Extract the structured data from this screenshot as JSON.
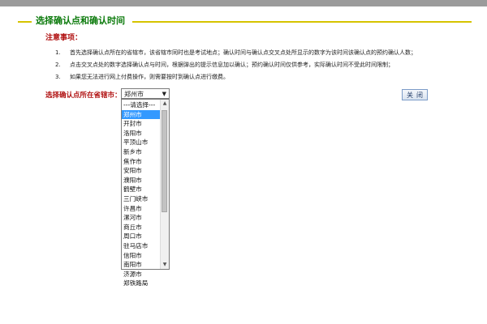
{
  "header": {
    "title": "选择确认点和确认时间"
  },
  "notice": {
    "title": "注意事项：",
    "items": [
      {
        "num": "1.",
        "text": "首先选择确认点所在的省辖市，该省辖市同时也是考试地点；确认时间与确认点交叉点处所显示的数字为该时间该确认点的预约确认人数；"
      },
      {
        "num": "2.",
        "text": "点击交叉点处的数字选择确认点与时间，根据弹出的提示信息加以确认；预约确认时间仅供参考，实际确认时间不受此时间限制；"
      },
      {
        "num": "3.",
        "text": "如果您无法进行网上付费操作，则需要按时到确认点进行缴费。"
      }
    ]
  },
  "city_select": {
    "label": "选择确认点所在省辖市：",
    "selected": "郑州市",
    "options": [
      "---请选择---",
      "郑州市",
      "开封市",
      "洛阳市",
      "平顶山市",
      "新乡市",
      "焦作市",
      "安阳市",
      "濮阳市",
      "鹤壁市",
      "三门峡市",
      "许昌市",
      "漯河市",
      "商丘市",
      "周口市",
      "驻马店市",
      "信阳市",
      "南阳市",
      "济源市",
      "郑铁路局"
    ]
  },
  "close_button": {
    "label": "关闭"
  },
  "scrollbar": {
    "up_icon": "▲",
    "down_icon": "▼"
  },
  "colors": {
    "title_green": "#0b7a0b",
    "accent_yellow": "#d6c400",
    "label_red": "#b01010",
    "highlight_blue": "#3399ff"
  }
}
